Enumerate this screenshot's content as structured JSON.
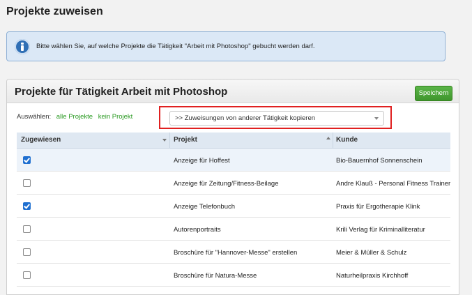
{
  "page": {
    "title": "Projekte zuweisen"
  },
  "info": {
    "icon": "info-icon",
    "text": "Bitte wählen Sie, auf welche Projekte die Tätigkeit \"Arbeit mit Photoshop\" gebucht werden darf."
  },
  "panel": {
    "title": "Projekte für Tätigkeit Arbeit mit Photoshop",
    "save_label": "Speichern",
    "select_label": "Auswählen:",
    "all_projects": "alle Projekte",
    "no_project": "kein Projekt",
    "copy_dropdown_value": ">> Zuweisungen von anderer Tätigkeit kopieren"
  },
  "table": {
    "columns": [
      "Zugewiesen",
      "Projekt",
      "Kunde"
    ],
    "rows": [
      {
        "assigned": true,
        "projekt": "Anzeige für Hoffest",
        "kunde": "Bio-Bauernhof Sonnenschein"
      },
      {
        "assigned": false,
        "projekt": "Anzeige für Zeitung/Fitness-Beilage",
        "kunde": "Andre Klauß - Personal Fitness Trainer"
      },
      {
        "assigned": true,
        "projekt": "Anzeige Telefonbuch",
        "kunde": "Praxis für Ergotherapie Klink"
      },
      {
        "assigned": false,
        "projekt": "Autorenportraits",
        "kunde": "Krili Verlag für Kriminalliteratur"
      },
      {
        "assigned": false,
        "projekt": "Broschüre für \"Hannover-Messe\" erstellen",
        "kunde": "Meier & Müller & Schulz"
      },
      {
        "assigned": false,
        "projekt": "Broschüre für Natura-Messe",
        "kunde": "Naturheilpraxis Kirchhoff"
      },
      {
        "assigned": false,
        "projekt": "",
        "kunde": ""
      }
    ]
  },
  "colors": {
    "accent_green": "#3f962d",
    "highlight_red": "#e02020",
    "info_bg": "#dbe8f6"
  }
}
